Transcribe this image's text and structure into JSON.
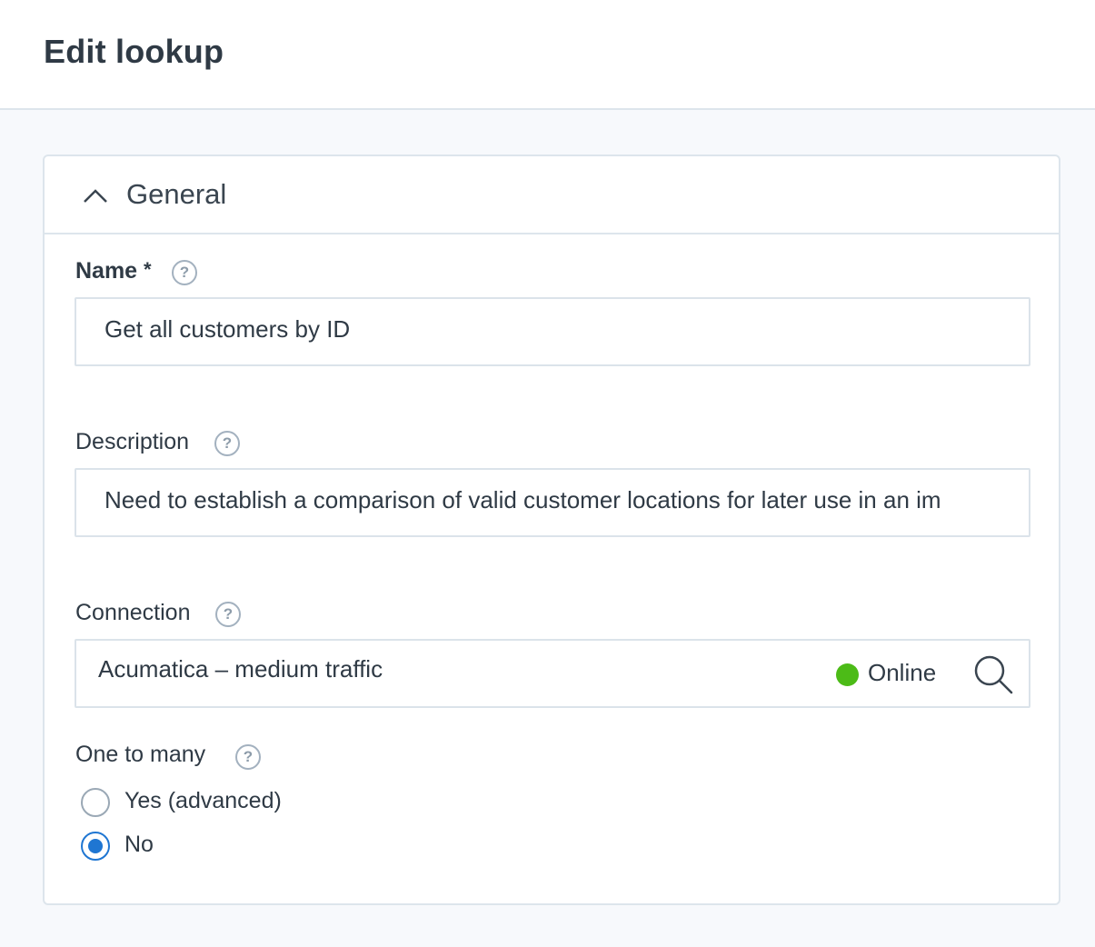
{
  "header": {
    "title": "Edit lookup"
  },
  "section": {
    "title": "General"
  },
  "fields": {
    "name": {
      "label": "Name",
      "required_mark": "*",
      "value": "Get all customers by ID"
    },
    "description": {
      "label": "Description",
      "value": "Need to establish a comparison of valid customer locations for later use in an im"
    },
    "connection": {
      "label": "Connection",
      "value": "Acumatica – medium traffic",
      "status": "Online",
      "status_color": "#4cbb17"
    },
    "one_to_many": {
      "label": "One to many",
      "options": [
        {
          "label": "Yes (advanced)",
          "selected": false
        },
        {
          "label": "No",
          "selected": true
        }
      ]
    }
  },
  "help_glyph": "?",
  "colors": {
    "accent": "#1f76d2",
    "online": "#4cbb17",
    "border": "#dde5ec"
  },
  "icons": [
    "chevron-up-icon",
    "help-icon",
    "status-dot-icon",
    "search-icon"
  ]
}
